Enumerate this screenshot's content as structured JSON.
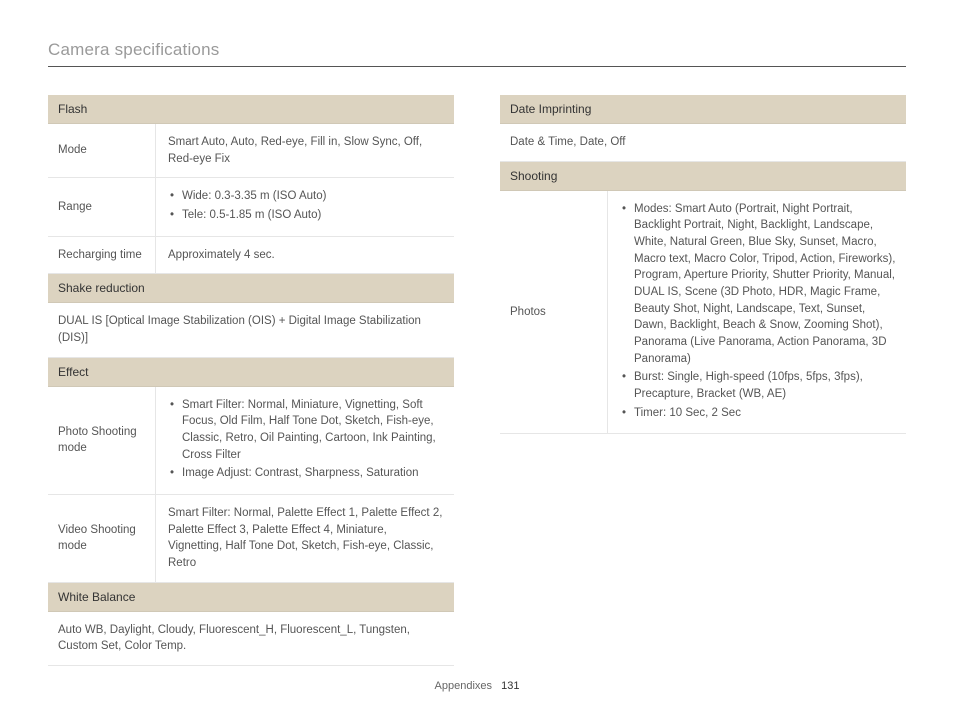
{
  "title": "Camera specifications",
  "left": {
    "flash_header": "Flash",
    "mode_label": "Mode",
    "mode_value": "Smart Auto, Auto, Red-eye, Fill in, Slow Sync, Off, Red-eye Fix",
    "range_label": "Range",
    "range_bullets": [
      "Wide: 0.3-3.35 m (ISO Auto)",
      "Tele: 0.5-1.85 m (ISO Auto)"
    ],
    "recharge_label": "Recharging time",
    "recharge_value": "Approximately 4 sec.",
    "shake_header": "Shake reduction",
    "shake_value": "DUAL IS [Optical Image Stabilization (OIS) + Digital Image Stabilization (DIS)]",
    "effect_header": "Effect",
    "photo_mode_label": "Photo Shooting mode",
    "photo_mode_bullets": [
      "Smart Filter: Normal, Miniature, Vignetting, Soft Focus, Old Film, Half Tone Dot, Sketch, Fish-eye, Classic, Retro, Oil Painting, Cartoon, Ink Painting, Cross Filter",
      "Image Adjust: Contrast, Sharpness, Saturation"
    ],
    "video_mode_label": "Video Shooting mode",
    "video_mode_value": "Smart Filter: Normal, Palette Effect 1, Palette Effect 2, Palette Effect 3, Palette Effect 4, Miniature, Vignetting, Half Tone Dot, Sketch, Fish-eye, Classic, Retro",
    "wb_header": "White Balance",
    "wb_value": "Auto WB, Daylight, Cloudy, Fluorescent_H, Fluorescent_L, Tungsten, Custom Set, Color Temp."
  },
  "right": {
    "date_header": "Date Imprinting",
    "date_value": "Date & Time, Date, Off",
    "shooting_header": "Shooting",
    "photos_label": "Photos",
    "photos_bullets": [
      "Modes: Smart Auto (Portrait, Night Portrait, Backlight Portrait, Night, Backlight, Landscape, White, Natural Green, Blue Sky, Sunset, Macro, Macro text, Macro Color, Tripod, Action, Fireworks), Program, Aperture Priority, Shutter Priority, Manual, DUAL IS, Scene (3D Photo, HDR, Magic Frame, Beauty Shot, Night, Landscape, Text, Sunset, Dawn, Backlight, Beach & Snow, Zooming Shot), Panorama (Live Panorama, Action Panorama, 3D Panorama)",
      "Burst: Single, High-speed  (10fps, 5fps, 3fps), Precapture, Bracket (WB, AE)",
      "Timer: 10 Sec, 2 Sec"
    ]
  },
  "footer_label": "Appendixes",
  "page_number": "131"
}
